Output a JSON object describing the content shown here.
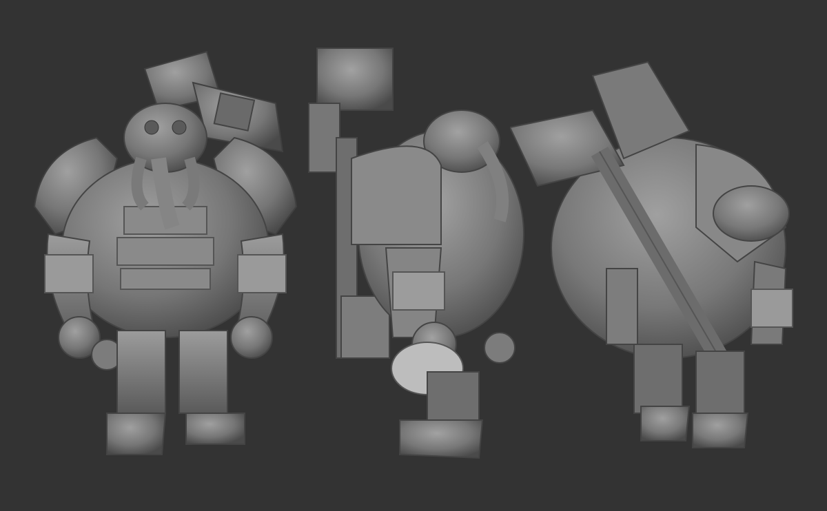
{
  "scene": {
    "background_color": "#333333",
    "clay_color": "#7a7a7a",
    "clay_light": "#9a9a9a",
    "clay_dark": "#4e4e4e",
    "views": [
      {
        "id": "front",
        "semantic": "character-front-view"
      },
      {
        "id": "side",
        "semantic": "character-side-view"
      },
      {
        "id": "back",
        "semantic": "character-back-three-quarter-view"
      }
    ]
  }
}
